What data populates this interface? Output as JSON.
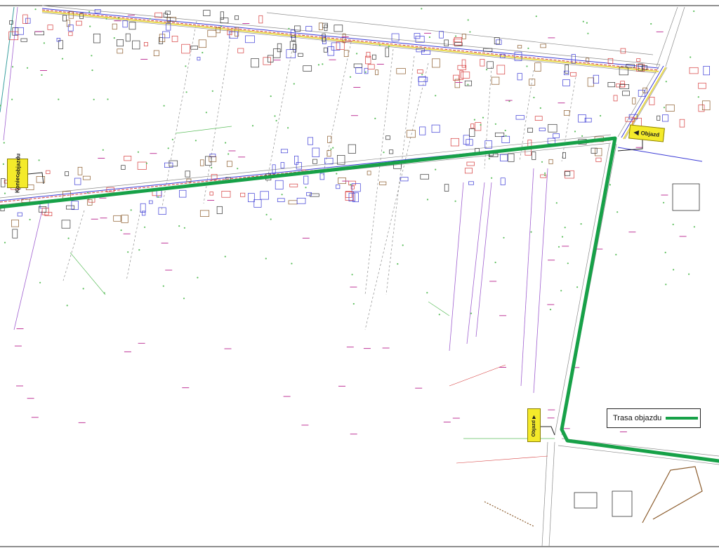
{
  "map": {
    "background": "#ffffff",
    "route_color": "#17a148",
    "route_line_label": "Trasa objazdu"
  },
  "signs": {
    "end": {
      "line1": "Koniec",
      "line2": "objazdu",
      "icon": "detour-end-sign"
    },
    "start": {
      "label": "Objazd",
      "icon": "left-arrow-icon"
    },
    "south": {
      "label": "Objazd",
      "icon": "up-arrow-icon"
    }
  },
  "legend": {
    "label": "Trasa objazdu",
    "swatch_color": "#17a148"
  },
  "colors": {
    "road_lines": "#9a9a9a",
    "utility_blue": "#3b3bd6",
    "utility_red": "#d63b3b",
    "utility_magenta": "#c0399a",
    "utility_green": "#5fbf5f",
    "utility_yellow": "#e8d84a",
    "utility_brown": "#8a5a2a"
  }
}
